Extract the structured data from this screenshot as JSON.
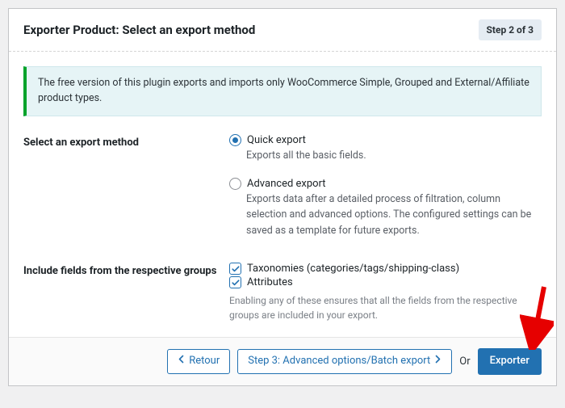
{
  "header": {
    "title": "Exporter Product: Select an export method",
    "step_badge": "Step 2 of 3"
  },
  "notice": {
    "text": "The free version of this plugin exports and imports only WooCommerce Simple, Grouped and External/Affiliate product types."
  },
  "method_section": {
    "label": "Select an export method",
    "options": [
      {
        "value": "quick",
        "label": "Quick export",
        "description": "Exports all the basic fields.",
        "selected": true
      },
      {
        "value": "advanced",
        "label": "Advanced export",
        "description": "Exports data after a detailed process of filtration, column selection and advanced options. The configured settings can be saved as a template for future exports.",
        "selected": false
      }
    ]
  },
  "fields_section": {
    "label": "Include fields from the respective groups",
    "checkboxes": [
      {
        "value": "taxonomies",
        "label": "Taxonomies (categories/tags/shipping-class)",
        "checked": true
      },
      {
        "value": "attributes",
        "label": "Attributes",
        "checked": true
      }
    ],
    "helper": "Enabling any of these ensures that all the fields from the respective groups are included in your export."
  },
  "footer": {
    "back_label": "Retour",
    "next_label": "Step 3: Advanced options/Batch export",
    "or_text": "Or",
    "export_label": "Exporter"
  }
}
